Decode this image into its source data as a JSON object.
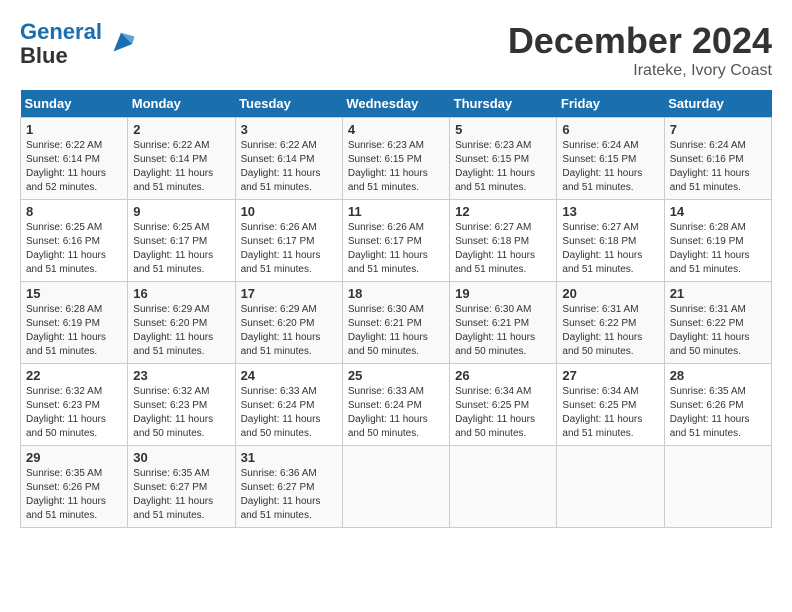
{
  "header": {
    "logo_line1": "General",
    "logo_line2": "Blue",
    "month_title": "December 2024",
    "location": "Irateke, Ivory Coast"
  },
  "days_of_week": [
    "Sunday",
    "Monday",
    "Tuesday",
    "Wednesday",
    "Thursday",
    "Friday",
    "Saturday"
  ],
  "weeks": [
    [
      {
        "day": "1",
        "sunrise": "6:22 AM",
        "sunset": "6:14 PM",
        "daylight": "11 hours and 52 minutes."
      },
      {
        "day": "2",
        "sunrise": "6:22 AM",
        "sunset": "6:14 PM",
        "daylight": "11 hours and 51 minutes."
      },
      {
        "day": "3",
        "sunrise": "6:22 AM",
        "sunset": "6:14 PM",
        "daylight": "11 hours and 51 minutes."
      },
      {
        "day": "4",
        "sunrise": "6:23 AM",
        "sunset": "6:15 PM",
        "daylight": "11 hours and 51 minutes."
      },
      {
        "day": "5",
        "sunrise": "6:23 AM",
        "sunset": "6:15 PM",
        "daylight": "11 hours and 51 minutes."
      },
      {
        "day": "6",
        "sunrise": "6:24 AM",
        "sunset": "6:15 PM",
        "daylight": "11 hours and 51 minutes."
      },
      {
        "day": "7",
        "sunrise": "6:24 AM",
        "sunset": "6:16 PM",
        "daylight": "11 hours and 51 minutes."
      }
    ],
    [
      {
        "day": "8",
        "sunrise": "6:25 AM",
        "sunset": "6:16 PM",
        "daylight": "11 hours and 51 minutes."
      },
      {
        "day": "9",
        "sunrise": "6:25 AM",
        "sunset": "6:17 PM",
        "daylight": "11 hours and 51 minutes."
      },
      {
        "day": "10",
        "sunrise": "6:26 AM",
        "sunset": "6:17 PM",
        "daylight": "11 hours and 51 minutes."
      },
      {
        "day": "11",
        "sunrise": "6:26 AM",
        "sunset": "6:17 PM",
        "daylight": "11 hours and 51 minutes."
      },
      {
        "day": "12",
        "sunrise": "6:27 AM",
        "sunset": "6:18 PM",
        "daylight": "11 hours and 51 minutes."
      },
      {
        "day": "13",
        "sunrise": "6:27 AM",
        "sunset": "6:18 PM",
        "daylight": "11 hours and 51 minutes."
      },
      {
        "day": "14",
        "sunrise": "6:28 AM",
        "sunset": "6:19 PM",
        "daylight": "11 hours and 51 minutes."
      }
    ],
    [
      {
        "day": "15",
        "sunrise": "6:28 AM",
        "sunset": "6:19 PM",
        "daylight": "11 hours and 51 minutes."
      },
      {
        "day": "16",
        "sunrise": "6:29 AM",
        "sunset": "6:20 PM",
        "daylight": "11 hours and 51 minutes."
      },
      {
        "day": "17",
        "sunrise": "6:29 AM",
        "sunset": "6:20 PM",
        "daylight": "11 hours and 51 minutes."
      },
      {
        "day": "18",
        "sunrise": "6:30 AM",
        "sunset": "6:21 PM",
        "daylight": "11 hours and 50 minutes."
      },
      {
        "day": "19",
        "sunrise": "6:30 AM",
        "sunset": "6:21 PM",
        "daylight": "11 hours and 50 minutes."
      },
      {
        "day": "20",
        "sunrise": "6:31 AM",
        "sunset": "6:22 PM",
        "daylight": "11 hours and 50 minutes."
      },
      {
        "day": "21",
        "sunrise": "6:31 AM",
        "sunset": "6:22 PM",
        "daylight": "11 hours and 50 minutes."
      }
    ],
    [
      {
        "day": "22",
        "sunrise": "6:32 AM",
        "sunset": "6:23 PM",
        "daylight": "11 hours and 50 minutes."
      },
      {
        "day": "23",
        "sunrise": "6:32 AM",
        "sunset": "6:23 PM",
        "daylight": "11 hours and 50 minutes."
      },
      {
        "day": "24",
        "sunrise": "6:33 AM",
        "sunset": "6:24 PM",
        "daylight": "11 hours and 50 minutes."
      },
      {
        "day": "25",
        "sunrise": "6:33 AM",
        "sunset": "6:24 PM",
        "daylight": "11 hours and 50 minutes."
      },
      {
        "day": "26",
        "sunrise": "6:34 AM",
        "sunset": "6:25 PM",
        "daylight": "11 hours and 50 minutes."
      },
      {
        "day": "27",
        "sunrise": "6:34 AM",
        "sunset": "6:25 PM",
        "daylight": "11 hours and 51 minutes."
      },
      {
        "day": "28",
        "sunrise": "6:35 AM",
        "sunset": "6:26 PM",
        "daylight": "11 hours and 51 minutes."
      }
    ],
    [
      {
        "day": "29",
        "sunrise": "6:35 AM",
        "sunset": "6:26 PM",
        "daylight": "11 hours and 51 minutes."
      },
      {
        "day": "30",
        "sunrise": "6:35 AM",
        "sunset": "6:27 PM",
        "daylight": "11 hours and 51 minutes."
      },
      {
        "day": "31",
        "sunrise": "6:36 AM",
        "sunset": "6:27 PM",
        "daylight": "11 hours and 51 minutes."
      },
      {
        "day": "",
        "sunrise": "",
        "sunset": "",
        "daylight": ""
      },
      {
        "day": "",
        "sunrise": "",
        "sunset": "",
        "daylight": ""
      },
      {
        "day": "",
        "sunrise": "",
        "sunset": "",
        "daylight": ""
      },
      {
        "day": "",
        "sunrise": "",
        "sunset": "",
        "daylight": ""
      }
    ]
  ]
}
